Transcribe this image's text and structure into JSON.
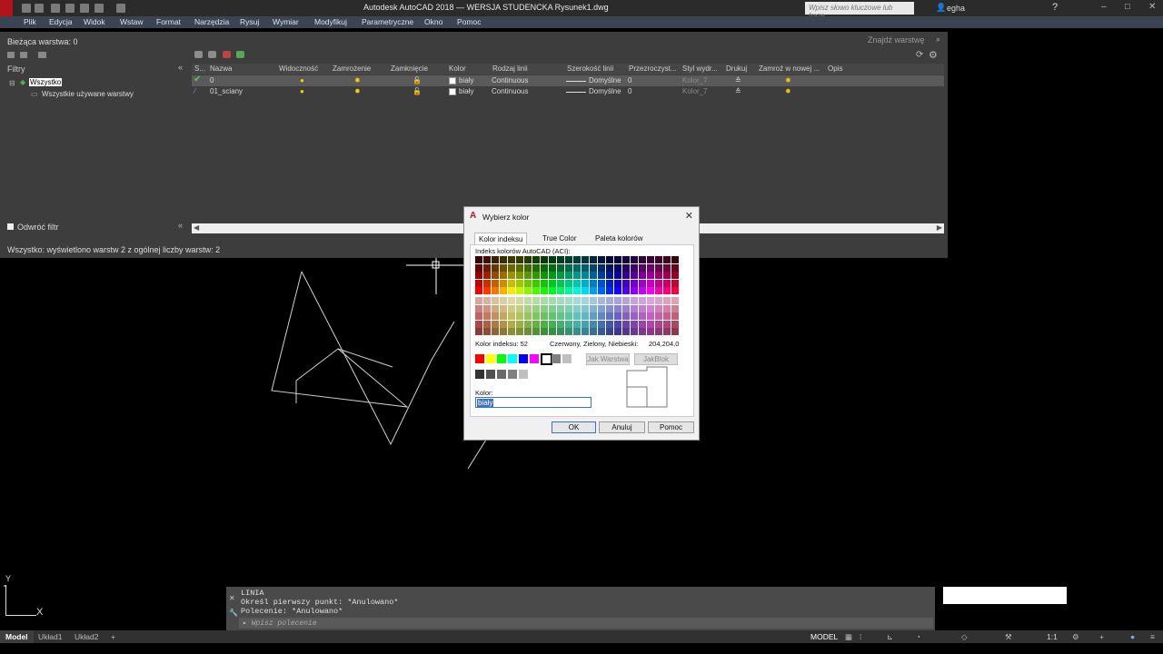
{
  "window": {
    "title": "Autodesk AutoCAD 2018 — WERSJA STUDENCKA    Rysunek1.dwg",
    "search_placeholder": "Wpisz słowo kluczowe lub frazę",
    "user": "egha"
  },
  "menu": [
    "Plik",
    "Edycja",
    "Widok",
    "Wstaw",
    "Format",
    "Narzędzia",
    "Rysuj",
    "Wymiar",
    "Modyfikuj",
    "Parametryczne",
    "Okno",
    "Pomoc"
  ],
  "layer_panel": {
    "current_layer": "Bieżąca warstwa: 0",
    "find_placeholder": "Znajdź warstwę",
    "filters_label": "Filtry",
    "tree": [
      "Wszystko",
      "Wszystkie używane warstwy"
    ],
    "invert_filter": "Odwróć filtr",
    "status": "Wszystko: wyświetlono warstw 2 z ogólnej liczby warstw: 2",
    "columns": [
      "S...",
      "Nazwa",
      "Widoczność",
      "Zamrożenie",
      "Zamknięcie",
      "Kolor",
      "Rodzaj linii",
      "Szerokość linii",
      "Przezroczyst...",
      "Styl wydr...",
      "Drukuj",
      "Zamroź w nowej ...",
      "Opis"
    ],
    "rows": [
      {
        "name": "0",
        "color": "biały",
        "linetype": "Continuous",
        "lineweight": "Domyślne",
        "transparency": "0",
        "plotstyle": "Kolor_7"
      },
      {
        "name": "01_sciany",
        "color": "biały",
        "linetype": "Continuous",
        "lineweight": "Domyślne",
        "transparency": "0",
        "plotstyle": "Kolor_7"
      }
    ]
  },
  "dialog": {
    "title": "Wybierz kolor",
    "tabs": [
      "Kolor indeksu",
      "True Color",
      "Paleta kolorów"
    ],
    "aci_label": "Indeks kolorów AutoCAD (ACI):",
    "index_label": "Kolor indeksu: 52",
    "rgb_label": "Czerwony, Zielony, Niebieski:",
    "rgb_value": "204,204,0",
    "bylayer": "Jak Warstwa",
    "byblock": "JakBlok",
    "color_label": "Kolor:",
    "color_value": "biały",
    "ok": "OK",
    "cancel": "Anuluj",
    "help": "Pomoc"
  },
  "command": {
    "lines": [
      "LINIA",
      "Określ pierwszy punkt: *Anulowano*",
      "Polecenie: *Anulowano*"
    ],
    "placeholder": "Wpisz polecenie"
  },
  "statusbar": {
    "tabs": [
      "Model",
      "Układ1",
      "Układ2"
    ],
    "model": "MODEL",
    "scale": "1:1"
  },
  "axes": {
    "y": "Y",
    "x": "X"
  }
}
